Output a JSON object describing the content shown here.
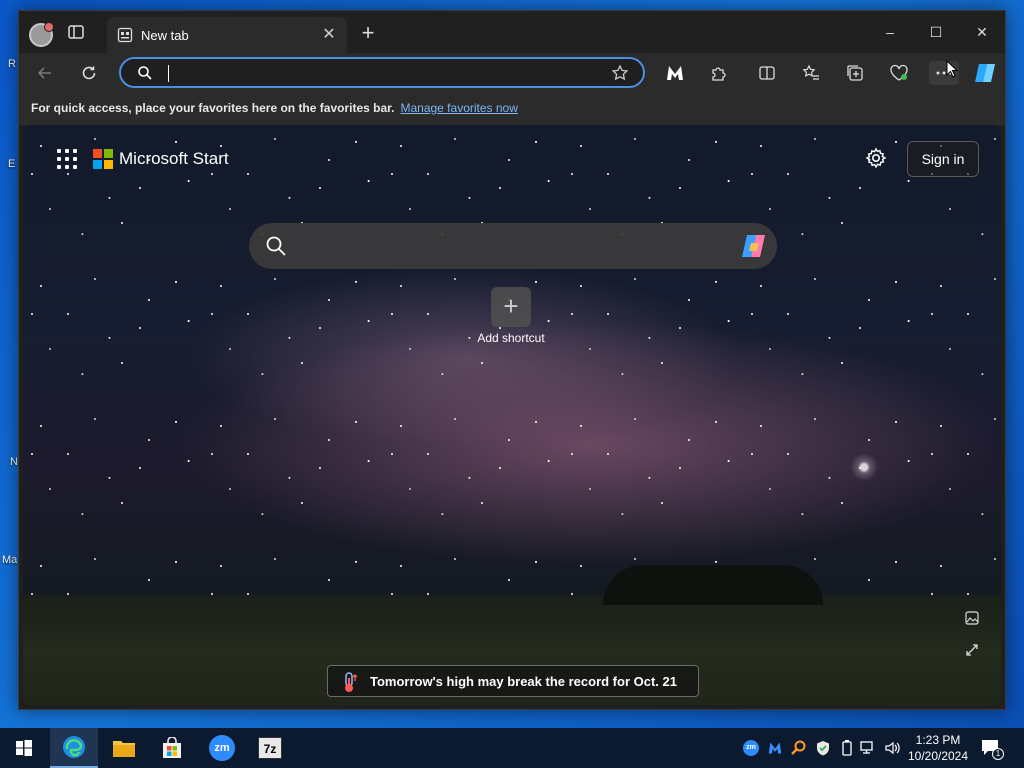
{
  "desktop": {
    "icon_labels": [
      "R",
      "E",
      "N",
      "Ma"
    ]
  },
  "tab": {
    "title": "New tab"
  },
  "window_controls": {
    "minimize": "–",
    "maximize": "☐",
    "close": "✕"
  },
  "address_bar": {
    "value": "",
    "placeholder": ""
  },
  "favorites_bar": {
    "message": "For quick access, place your favorites here on the favorites bar.",
    "link": "Manage favorites now"
  },
  "new_tab_page": {
    "brand": "Microsoft Start",
    "sign_in": "Sign in",
    "search_placeholder": "",
    "add_shortcut": "Add shortcut",
    "news_headline": "Tomorrow's high may break the record for Oct. 21"
  },
  "colors": {
    "accent": "#4a8fe0",
    "link": "#7cb6f5",
    "ms_red": "#f25022",
    "ms_green": "#7fba00",
    "ms_blue": "#00a4ef",
    "ms_yellow": "#ffb900"
  },
  "taskbar": {
    "apps": [
      "start-icon",
      "edge-icon",
      "file-explorer-icon",
      "microsoft-store-icon",
      "zoom-icon",
      "7zip-icon"
    ],
    "zoom_label": "zm",
    "sevenzip_label": "7z",
    "time": "1:23 PM",
    "date": "10/20/2024",
    "notification_count": "1"
  }
}
